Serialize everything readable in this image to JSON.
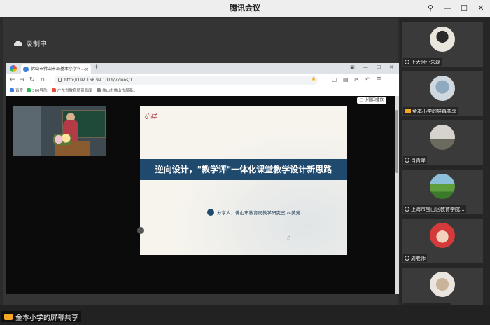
{
  "window": {
    "title": "腾讯会议"
  },
  "stage": {
    "recording_label": "录制中"
  },
  "browser": {
    "tab_title": "佛山市佛山市局基本小学科...",
    "url": "http://192.168.99.101/l/videos/1",
    "bookmarks": [
      "百度",
      "360导航",
      "广东省教育局资源库",
      "佛山市佛山市局基..."
    ],
    "small_window_button": "□ 小窗口播放"
  },
  "slide": {
    "logo_text": "小样",
    "title": "逆向设计，\"教学评\"一体化课堂教学设计新思路",
    "presenter": "分享人：佛山市教育局教学研究室  林美芳"
  },
  "participants": [
    {
      "name": "上大附小朱磊",
      "screen_share": false
    },
    {
      "name": "金本小学的屏幕共享",
      "screen_share": true
    },
    {
      "name": "肖青峰",
      "screen_share": false
    },
    {
      "name": "上海市宝山区教育学院...",
      "screen_share": false
    },
    {
      "name": "周老师",
      "screen_share": false
    },
    {
      "name": "上海大学附属小学",
      "screen_share": false
    }
  ],
  "bottom": {
    "sharing_label": "金本小学的屏幕共享"
  },
  "colors": {
    "slide_band": "#1f4a6e",
    "share_badge": "#f5a623"
  }
}
